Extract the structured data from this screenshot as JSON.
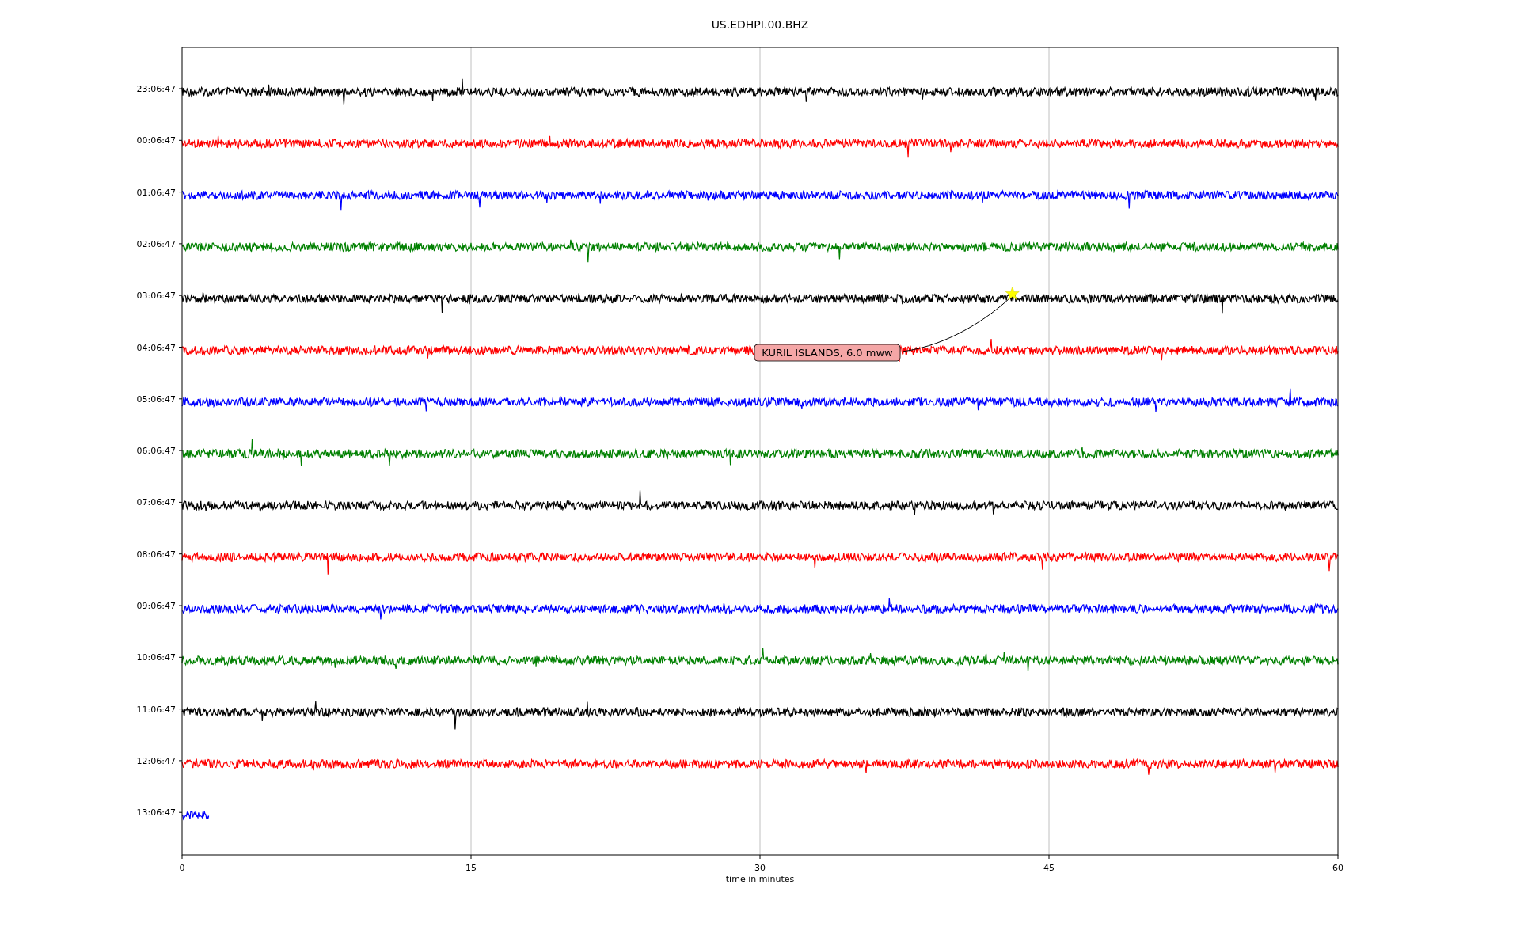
{
  "title": "US.EDHPI.00.BHZ",
  "xlabel": "time in minutes",
  "xticks": [
    "0",
    "15",
    "30",
    "45",
    "60"
  ],
  "traces": [
    {
      "label": "23:06:47",
      "color": "#000000",
      "level": 1
    },
    {
      "label": "00:06:47",
      "color": "#ff0000",
      "level": 1
    },
    {
      "label": "01:06:47",
      "color": "#0000ff",
      "level": 1
    },
    {
      "label": "02:06:47",
      "color": "#008000",
      "level": 1
    },
    {
      "label": "03:06:47",
      "color": "#000000",
      "level": 1
    },
    {
      "label": "04:06:47",
      "color": "#ff0000",
      "level": 1
    },
    {
      "label": "05:06:47",
      "color": "#0000ff",
      "level": 1
    },
    {
      "label": "06:06:47",
      "color": "#008000",
      "level": 1
    },
    {
      "label": "07:06:47",
      "color": "#000000",
      "level": 1
    },
    {
      "label": "08:06:47",
      "color": "#ff0000",
      "level": 1
    },
    {
      "label": "09:06:47",
      "color": "#0000ff",
      "level": 1
    },
    {
      "label": "10:06:47",
      "color": "#008000",
      "level": 1
    },
    {
      "label": "11:06:47",
      "color": "#000000",
      "level": 1
    },
    {
      "label": "12:06:47",
      "color": "#ff0000",
      "level": 1
    },
    {
      "label": "13:06:47",
      "color": "#0000ff",
      "level": 0.023
    }
  ],
  "event": {
    "label": "KURIL ISLANDS, 6.0 mww"
  }
}
